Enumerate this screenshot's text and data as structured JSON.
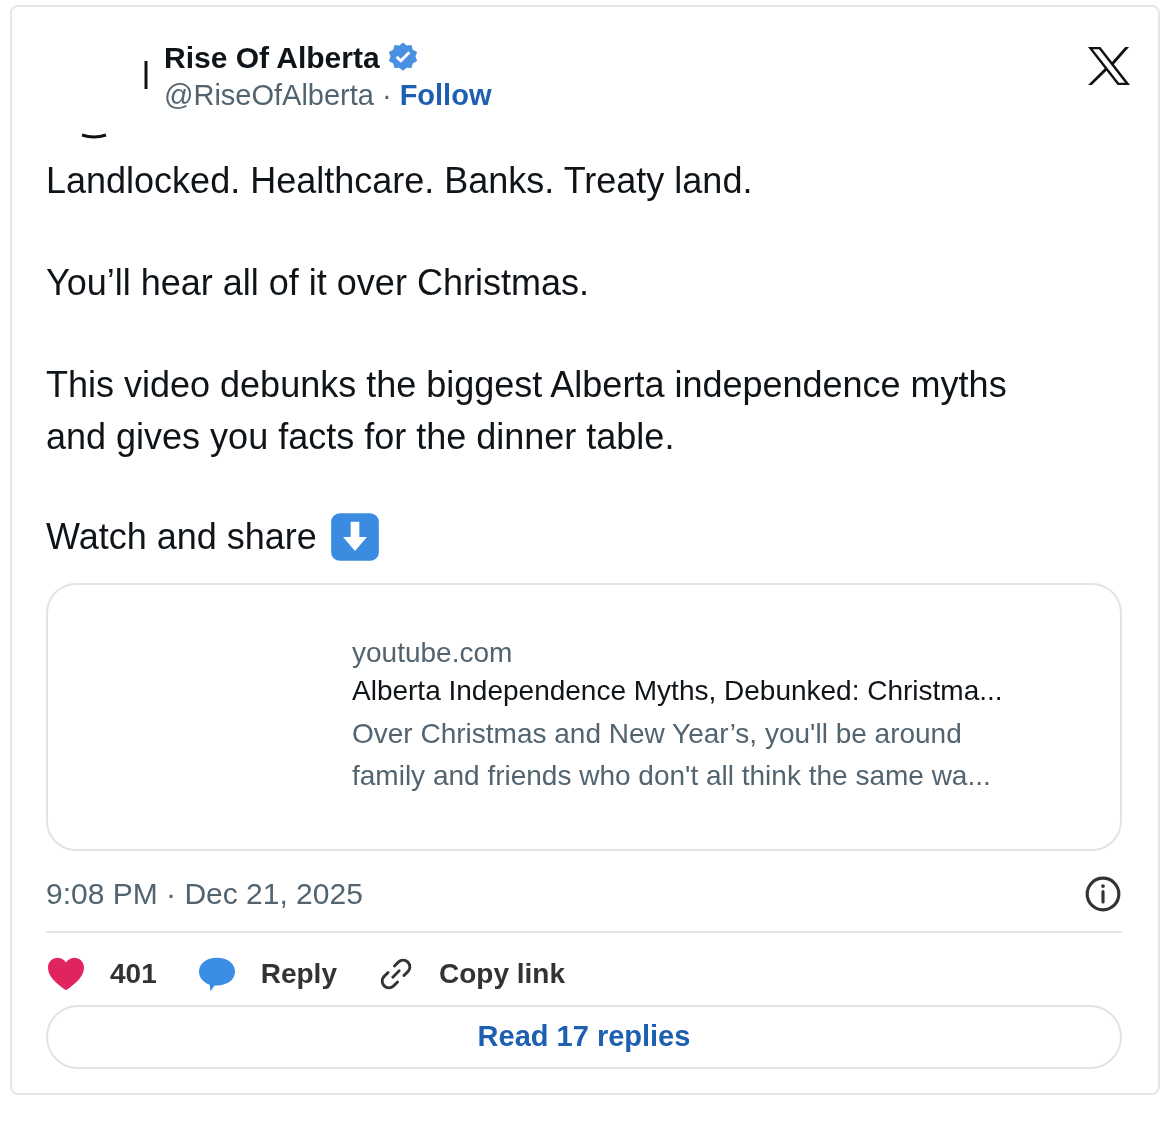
{
  "author": {
    "name": "Rise Of Alberta",
    "verified": true,
    "handle": "@RiseOfAlberta",
    "separator": "·",
    "follow": "Follow"
  },
  "paragraphs": [
    "Landlocked. Healthcare. Banks. Treaty land.",
    "You’ll hear all of it over Christmas.",
    "This video debunks the biggest Alberta independence myths and gives you facts for the dinner table."
  ],
  "closing": {
    "text": "Watch and share"
  },
  "link_card": {
    "domain": "youtube.com",
    "title": "Alberta Independence Myths, Debunked: Christma...",
    "description": "Over Christmas and New Year’s, you'll be around family and friends who don't all think the same wa..."
  },
  "timestamp": "9:08 PM · Dec 21, 2025",
  "actions": [
    {
      "kind": "like",
      "label": "401"
    },
    {
      "kind": "reply",
      "label": "Reply"
    },
    {
      "kind": "copy",
      "label": "Copy link"
    }
  ],
  "read_replies": "Read 17 replies"
}
